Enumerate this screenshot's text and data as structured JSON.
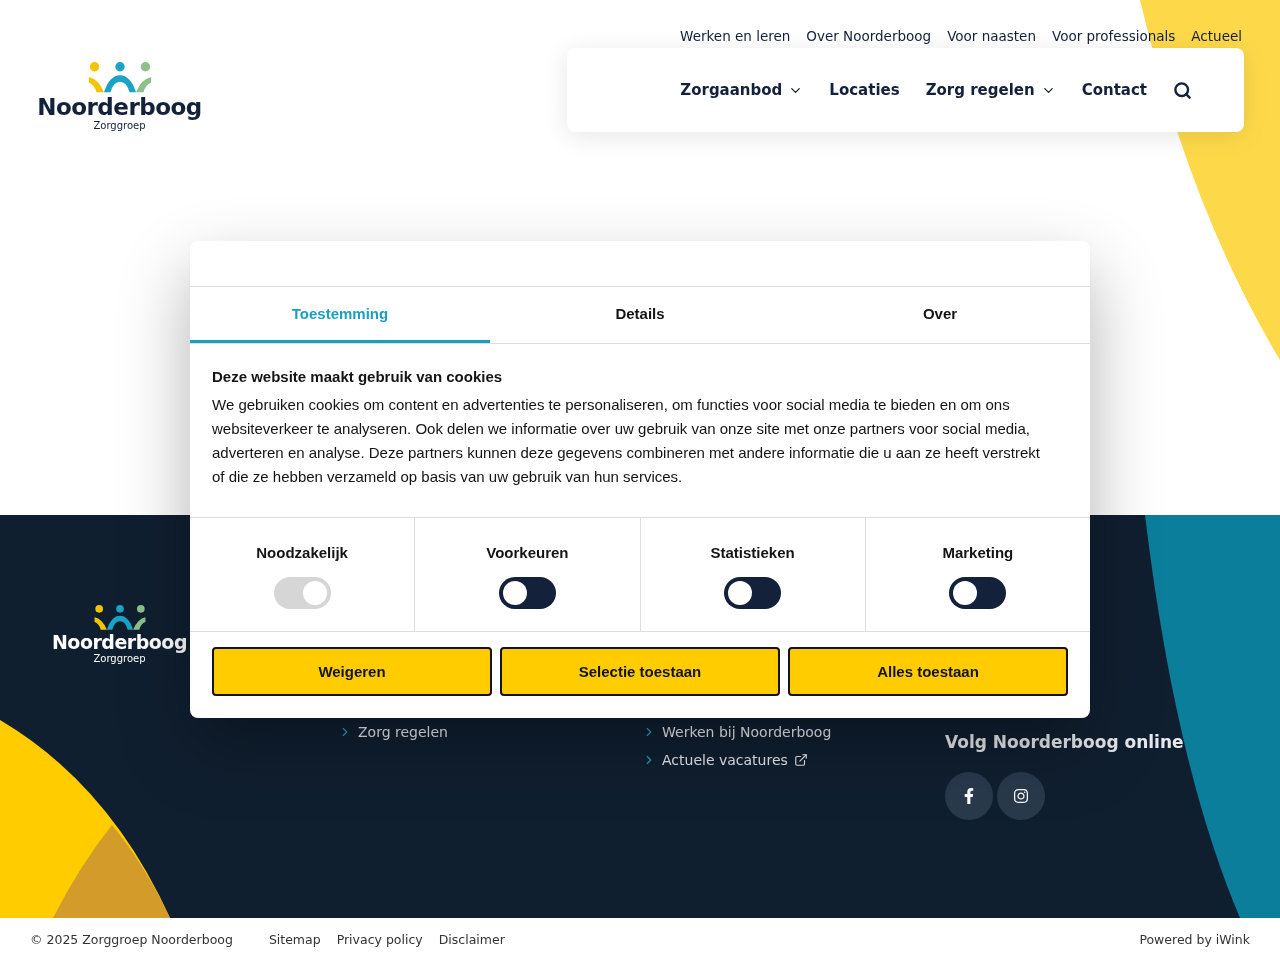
{
  "top_links": [
    "Werken en leren",
    "Over Noorderboog",
    "Voor naasten",
    "Voor professionals",
    "Actueel"
  ],
  "logo": {
    "name": "Noorderboog",
    "tagline": "Zorggroep"
  },
  "main_nav": [
    {
      "label": "Zorgaanbod",
      "dropdown": true
    },
    {
      "label": "Locaties",
      "dropdown": false
    },
    {
      "label": "Zorg regelen",
      "dropdown": true
    },
    {
      "label": "Contact",
      "dropdown": false
    }
  ],
  "cookie_dialog": {
    "tabs": [
      {
        "label": "Toestemming",
        "selected": true
      },
      {
        "label": "Details",
        "selected": false
      },
      {
        "label": "Over",
        "selected": false
      }
    ],
    "heading": "Deze website maakt gebruik van cookies",
    "body": "We gebruiken cookies om content en advertenties te personaliseren, om functies voor social media te bieden en om ons websiteverkeer te analyseren. Ook delen we informatie over uw gebruik van onze site met onze partners voor social media, adverteren en analyse. Deze partners kunnen deze gegevens combineren met andere informatie die u aan ze heeft verstrekt of die ze hebben verzameld op basis van uw gebruik van hun services.",
    "categories": [
      {
        "label": "Noodzakelijk",
        "checked": true,
        "disabled": true
      },
      {
        "label": "Voorkeuren",
        "checked": false,
        "disabled": false
      },
      {
        "label": "Statistieken",
        "checked": false,
        "disabled": false
      },
      {
        "label": "Marketing",
        "checked": false,
        "disabled": false
      }
    ],
    "buttons": [
      "Weigeren",
      "Selectie toestaan",
      "Alles toestaan"
    ]
  },
  "footer": {
    "logo": {
      "name": "Noorderboog",
      "tagline": "Zorggroep"
    },
    "links_col_1": [
      {
        "label": "Zorg regelen",
        "external": false
      }
    ],
    "links_col_2": [
      {
        "label": "Werken bij Noorderboog",
        "external": false
      },
      {
        "label": "Actuele vacatures",
        "external": true
      }
    ],
    "social_heading": "Volg Noorderboog online",
    "social": [
      {
        "kind": "facebook"
      },
      {
        "kind": "instagram"
      }
    ]
  },
  "bottom_bar": {
    "copyright": "© 2025 Zorggroep Noorderboog",
    "links": [
      "Sitemap",
      "Privacy policy",
      "Disclaimer"
    ],
    "powered_by": "Powered by iWink"
  }
}
